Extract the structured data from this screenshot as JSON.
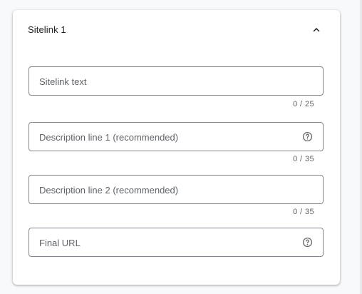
{
  "card": {
    "title": "Sitelink 1",
    "collapse_icon": "chevron-up-icon"
  },
  "fields": [
    {
      "placeholder": "Sitelink text",
      "counter": "0 / 25",
      "has_help": false
    },
    {
      "placeholder": "Description line 1 (recommended)",
      "counter": "0 / 35",
      "has_help": true
    },
    {
      "placeholder": "Description line 2 (recommended)",
      "counter": "0 / 35",
      "has_help": false
    },
    {
      "placeholder": "Final URL",
      "counter": "",
      "has_help": true
    }
  ],
  "colors": {
    "border": "#80868b",
    "text": "#202124",
    "muted": "#5f6368"
  }
}
